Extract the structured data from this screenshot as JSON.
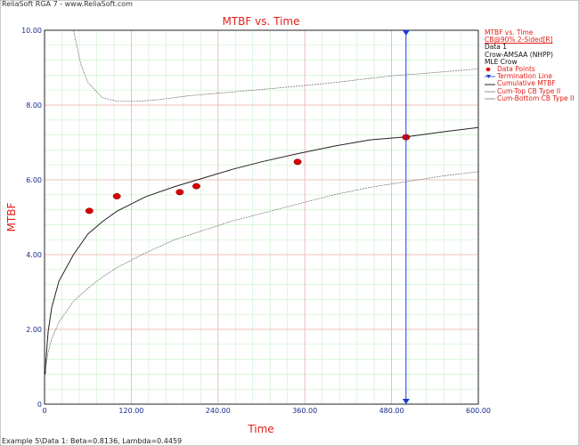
{
  "app_title": "ReliaSoft RGA 7 - www.ReliaSoft.com",
  "status_text": "Example 5\\Data 1: Beta=0.8136, Lambda=0.4459",
  "colors": {
    "title": "#e0201a",
    "axis_text": "#1a2a8c",
    "termination": "#1a3ad8",
    "points": "#d80000",
    "grid_major": "#f0b0b0",
    "grid_minor": "#c8f0c8"
  },
  "legend": {
    "title": "MTBF vs. Time",
    "subtitle": "CB@90% 2-Sided[R]",
    "group": "Data 1",
    "model": "Crow-AMSAA (NHPP)",
    "method": "MLE Crow",
    "items": [
      {
        "label": "Data Points",
        "icon": "red-dot-icon"
      },
      {
        "label": "Termination Line",
        "icon": "blue-triangle-icon"
      },
      {
        "label": "Cumulative MTBF",
        "icon": "black-line-icon"
      },
      {
        "label": "Cum-Top CB Type II",
        "icon": "gray-line-icon"
      },
      {
        "label": "Cum-Bottom CB Type II",
        "icon": "gray-line-icon"
      }
    ]
  },
  "chart_data": {
    "type": "line",
    "title": "MTBF vs. Time",
    "xlabel": "Time",
    "ylabel": "MTBF",
    "xlim": [
      0,
      600
    ],
    "ylim": [
      0,
      10
    ],
    "xticks": [
      0,
      120,
      240,
      360,
      480,
      600
    ],
    "xtick_labels": [
      "0",
      "120.00",
      "240.00",
      "360.00",
      "480.00",
      "600.00"
    ],
    "yticks": [
      0,
      2,
      4,
      6,
      8,
      10
    ],
    "ytick_labels": [
      "0",
      "2.00",
      "4.00",
      "6.00",
      "8.00",
      "10.00"
    ],
    "grid": true,
    "termination_time": 500,
    "data_points": {
      "name": "Data Points",
      "x": [
        62,
        100,
        187,
        210,
        350,
        500
      ],
      "y": [
        5.17,
        5.56,
        5.67,
        5.83,
        6.48,
        7.14
      ]
    },
    "series": [
      {
        "name": "Cumulative MTBF",
        "x": [
          1,
          2,
          5,
          10,
          20,
          40,
          60,
          80,
          100,
          140,
          180,
          220,
          260,
          300,
          350,
          400,
          450,
          500,
          550,
          600
        ],
        "y": [
          0.8,
          1.2,
          1.95,
          2.59,
          3.29,
          4.0,
          4.55,
          4.88,
          5.16,
          5.55,
          5.82,
          6.05,
          6.28,
          6.48,
          6.7,
          6.9,
          7.07,
          7.15,
          7.28,
          7.4
        ]
      },
      {
        "name": "Cum-Top CB Type II",
        "x": [
          40,
          50,
          60,
          80,
          100,
          130,
          160,
          200,
          260,
          320,
          400,
          480,
          540,
          600
        ],
        "y": [
          10.0,
          9.1,
          8.6,
          8.2,
          8.1,
          8.1,
          8.15,
          8.25,
          8.35,
          8.45,
          8.6,
          8.78,
          8.87,
          8.97
        ]
      },
      {
        "name": "Cum-Bottom CB Type II",
        "x": [
          1,
          5,
          10,
          20,
          40,
          60,
          80,
          100,
          140,
          180,
          220,
          260,
          300,
          350,
          400,
          450,
          500,
          550,
          600
        ],
        "y": [
          0.9,
          1.4,
          1.75,
          2.2,
          2.75,
          3.1,
          3.4,
          3.65,
          4.05,
          4.4,
          4.65,
          4.9,
          5.1,
          5.35,
          5.6,
          5.8,
          5.95,
          6.1,
          6.22
        ]
      }
    ]
  }
}
